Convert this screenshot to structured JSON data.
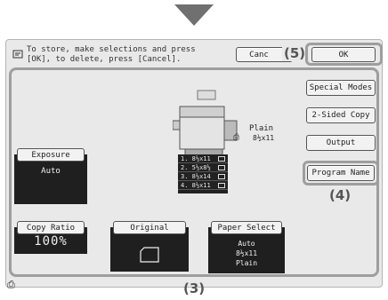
{
  "message": {
    "text": "To store, make selections and press\n[OK], to delete, press [Cancel]."
  },
  "top_buttons": {
    "cancel": "Canc",
    "ok": "OK"
  },
  "callouts": {
    "c3": "(3)",
    "c4": "(4)",
    "c5": "(5)"
  },
  "right_buttons": {
    "special_modes": "Special Modes",
    "two_sided": "2-Sided Copy",
    "output": "Output",
    "program_name": "Program Name"
  },
  "paper_status": {
    "type": "Plain",
    "size": "8½x11"
  },
  "trays": [
    {
      "label": "1. 8½x11"
    },
    {
      "label": "2. 5½x8½"
    },
    {
      "label": "3. 8½x14"
    },
    {
      "label": "4. 8½x11"
    }
  ],
  "exposure": {
    "label": "Exposure",
    "value": "Auto"
  },
  "copy_ratio": {
    "label": "Copy Ratio",
    "value": "100%"
  },
  "original": {
    "label": "Original"
  },
  "paper_select": {
    "label": "Paper Select",
    "line1": "Auto",
    "line2": "8½x11",
    "line3": "Plain"
  },
  "icons": {
    "message": "message-icon",
    "bottom_left": "side-marker-icon"
  }
}
